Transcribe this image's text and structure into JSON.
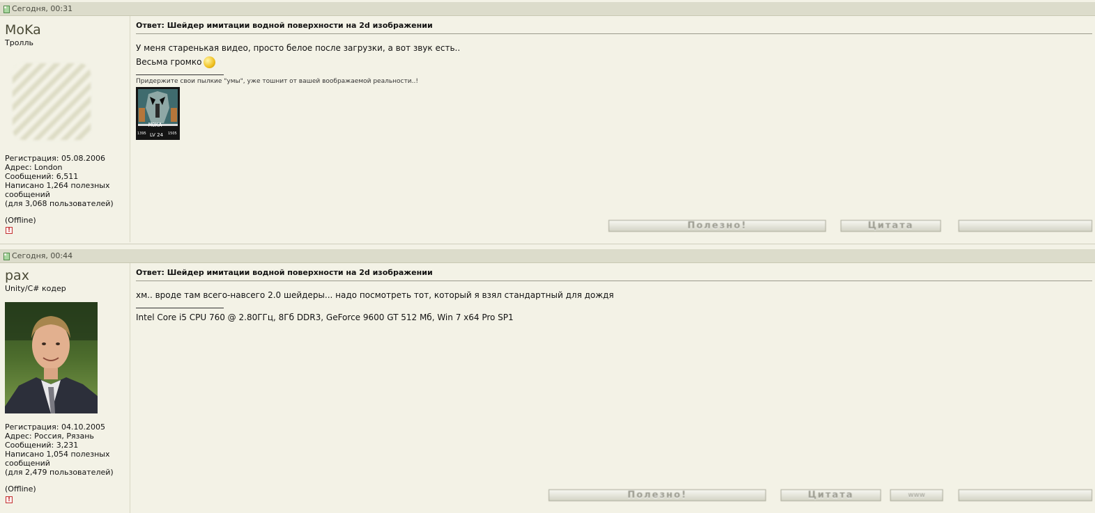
{
  "posts": [
    {
      "date": "Сегодня, 00:31",
      "username": "MoKa",
      "rank": "Тролль",
      "stats": {
        "registration": "Регистрация: 05.08.2006",
        "address": "Адрес: London",
        "messages": "Сообщений: 6,511",
        "useful_line1": "Написано 1,264 полезных",
        "useful_line2": "сообщений",
        "useful_line3": "(для 3,068 пользователей)"
      },
      "status": "(Offline)",
      "title": "Ответ: Шейдер имитации водной поверхности на 2d изображении",
      "body_line1": "У меня старенькая видео, просто белое после загрузки, а вот звук есть..",
      "body_line2": "Весьма громко",
      "signature": "Придержите свои пылкие \"умы\", уже тошнит от вашей воображаемой реальности..!",
      "sig_image_label": "MOKA",
      "sig_image_level": "LV 24",
      "sig_image_left": "1395",
      "sig_image_right": "1505",
      "buttons": {
        "useful": "Полезно!",
        "quote": "Цитата",
        "reply": ""
      }
    },
    {
      "date": "Сегодня, 00:44",
      "username": "pax",
      "rank": "Unity/C# кодер",
      "stats": {
        "registration": "Регистрация: 04.10.2005",
        "address": "Адрес: Россия, Рязань",
        "messages": "Сообщений: 3,231",
        "useful_line1": "Написано 1,054 полезных",
        "useful_line2": "сообщений",
        "useful_line3": "(для 2,479 пользователей)"
      },
      "status": "(Offline)",
      "title": "Ответ: Шейдер имитации водной поверхности на 2d изображении",
      "body_line1": "хм.. вроде там всего-навсего 2.0 шейдеры... надо посмотреть тот, который я взял стандартный для дождя",
      "signature": "Intel Core i5 CPU 760 @ 2.80ГГц, 8Гб DDR3, GeForce 9600 GT 512 Мб, Win 7 x64 Pro SP1",
      "buttons": {
        "useful": "Полезно!",
        "quote": "Цитата",
        "www": "www",
        "reply": ""
      }
    }
  ],
  "colors": {
    "background": "#f3f2e6",
    "header": "#dcdccb",
    "text": "#111111"
  }
}
